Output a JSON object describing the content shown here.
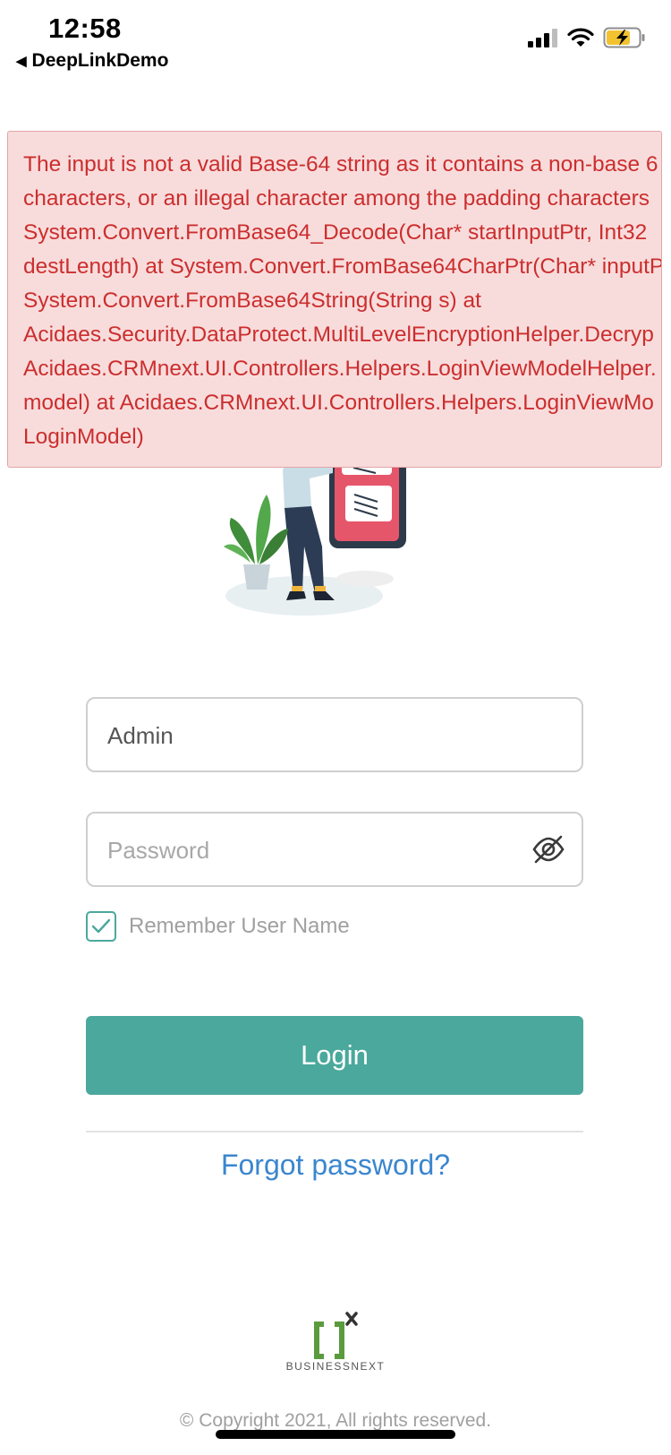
{
  "status_bar": {
    "time": "12:58",
    "back_app_label": "DeepLinkDemo",
    "battery_state": "charging"
  },
  "error": {
    "color": "#cc2e2e",
    "lines": [
      "The input is not a valid Base-64 string as it contains a non-base 6",
      "characters, or an illegal character among the padding characters",
      "System.Convert.FromBase64_Decode(Char* startInputPtr, Int32",
      "destLength) at System.Convert.FromBase64CharPtr(Char* inputP",
      "System.Convert.FromBase64String(String s) at",
      "Acidaes.Security.DataProtect.MultiLevelEncryptionHelper.Decryp",
      "Acidaes.CRMnext.UI.Controllers.Helpers.LoginViewModelHelper.",
      "model) at Acidaes.CRMnext.UI.Controllers.Helpers.LoginViewMo",
      "LoginModel)"
    ]
  },
  "login_form": {
    "username_value": "Admin",
    "password_placeholder": "Password",
    "password_visibility_icon": "eye-slash-icon",
    "remember_label": "Remember User Name",
    "remember_checked": true,
    "login_label": "Login",
    "forgot_label": "Forgot password?"
  },
  "footer": {
    "logo_text": "BUSINESSNEXT",
    "copyright": "© Copyright 2021, All rights reserved."
  },
  "colors": {
    "accent": "#4aa89c",
    "link": "#3a86cf",
    "error_bg": "#f8dcdc"
  }
}
